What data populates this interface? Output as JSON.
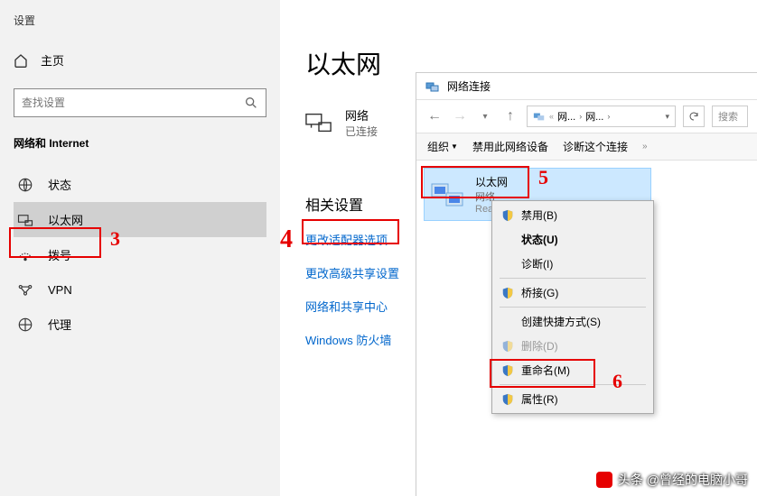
{
  "settings": {
    "window_title": "设置",
    "home": "主页",
    "search_placeholder": "查找设置",
    "section": "网络和 Internet",
    "nav": [
      {
        "label": "状态"
      },
      {
        "label": "以太网"
      },
      {
        "label": "拨号"
      },
      {
        "label": "VPN"
      },
      {
        "label": "代理"
      }
    ]
  },
  "main": {
    "heading": "以太网",
    "network_name": "网络",
    "network_status": "已连接",
    "related_heading": "相关设置",
    "links": [
      "更改适配器选项",
      "更改高级共享设置",
      "网络和共享中心",
      "Windows 防火墙"
    ]
  },
  "popup": {
    "title": "网络连接",
    "crumb1": "网...",
    "crumb2": "网...",
    "search_placeholder": "搜索",
    "menubar": {
      "organize": "组织",
      "disable": "禁用此网络设备",
      "diagnose": "诊断这个连接"
    },
    "adapter": {
      "name": "以太网",
      "desc": "网络",
      "driver": "Rea..."
    }
  },
  "context_menu": {
    "items": [
      {
        "label": "禁用(B)",
        "shield": true
      },
      {
        "label": "状态(U)",
        "bold": true
      },
      {
        "label": "诊断(I)"
      },
      {
        "sep": true
      },
      {
        "label": "桥接(G)",
        "shield": true
      },
      {
        "sep": true
      },
      {
        "label": "创建快捷方式(S)"
      },
      {
        "label": "删除(D)",
        "shield": true,
        "disabled": true
      },
      {
        "label": "重命名(M)",
        "shield": true
      },
      {
        "sep": true
      },
      {
        "label": "属性(R)",
        "shield": true
      }
    ]
  },
  "annotations": {
    "n3": "3",
    "n4": "4",
    "n5": "5",
    "n6": "6"
  },
  "watermark": "头条 @曾经的电脑小哥"
}
